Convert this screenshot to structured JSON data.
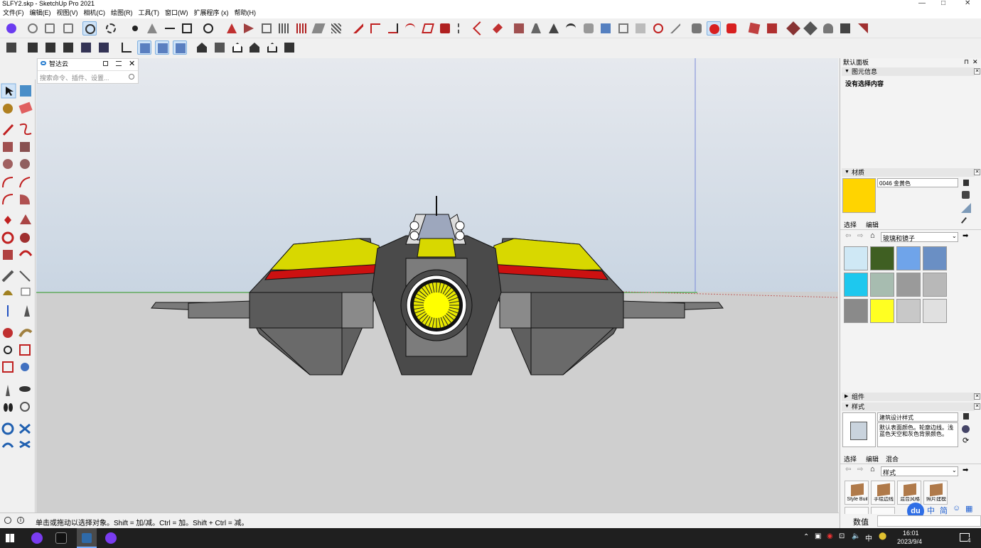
{
  "window": {
    "title": "SLFY2.skp - SketchUp Pro 2021",
    "controls": {
      "minimize": "—",
      "maximize": "□",
      "close": "✕"
    }
  },
  "menu": [
    "文件(F)",
    "编辑(E)",
    "视图(V)",
    "相机(C)",
    "绘图(R)",
    "工具(T)",
    "窗口(W)",
    "扩展程序 (x)",
    "帮助(H)"
  ],
  "search_panel": {
    "title": "智达云",
    "placeholder": "搜索命令、插件、设置..."
  },
  "right_panel": {
    "title": "默认面板",
    "entity_info": {
      "header": "图元信息",
      "content": "没有选择内容"
    },
    "materials": {
      "header": "材质",
      "material_name": "0046 金黄色",
      "current_color": "#FFD400",
      "tabs": [
        "选择",
        "编辑"
      ],
      "library": "玻璃和镜子",
      "swatch_colors": [
        "#cfe8f5",
        "#3f5f22",
        "#6fa4ea",
        "#6a8fc4",
        "#1ec8ee",
        "#a7bcb0",
        "#9a9a9a",
        "#b8b8b8",
        "#8a8a8a",
        "#ffff22",
        "#c8c8c8",
        "#e0e0e0"
      ]
    },
    "components": {
      "header": "组件"
    },
    "styles": {
      "header": "样式",
      "style_name": "建筑设计样式",
      "style_description": "默认表面颜色。轮廓边线。浅蓝色天空和灰色背景颜色。",
      "tabs": [
        "选择",
        "编辑",
        "混合"
      ],
      "library": "样式",
      "thumbs": [
        "Style Buil",
        "手绘边线",
        "混合风格",
        "照片建模"
      ]
    }
  },
  "status": {
    "hint": "单击或拖动以选择对象。Shift = 加/减。Ctrl = 加。Shift + Ctrl = 减。",
    "measurements_label": "数值"
  },
  "taskbar": {
    "time": "16:01",
    "date": "2023/9/4",
    "ime_main": "中",
    "ime_mode": "简",
    "notification_count": "4"
  },
  "scene": {
    "sky_color": "#d6dde5",
    "ground_color": "#cfcfcf",
    "ship_accent": "#d9d900",
    "ship_stripe": "#cc1111",
    "ship_hull": "#5a5a5a"
  }
}
